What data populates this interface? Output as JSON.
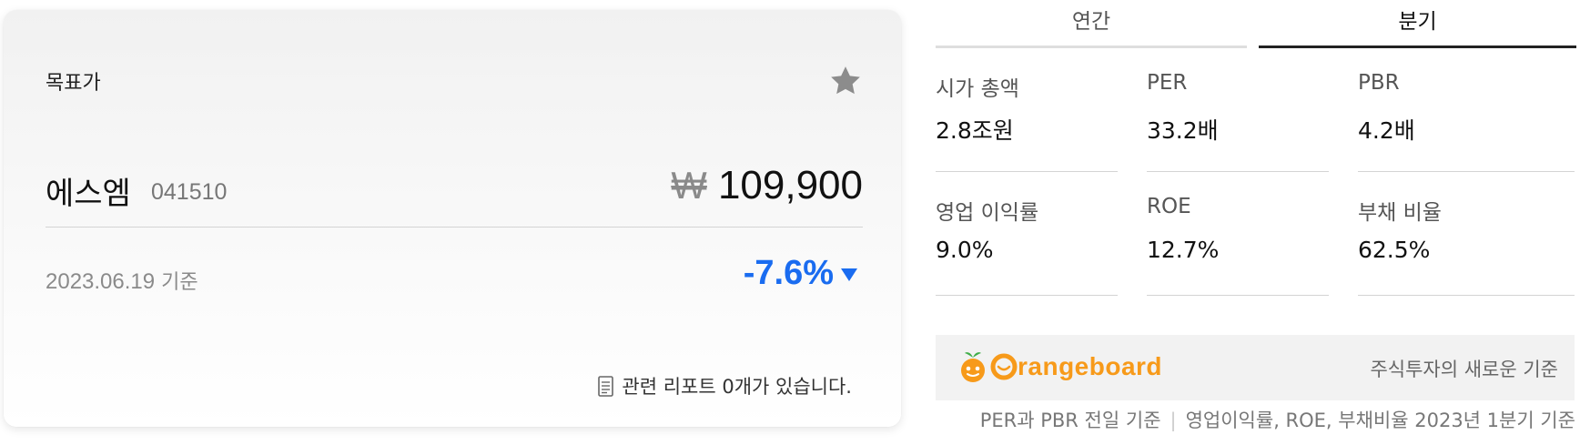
{
  "target_card": {
    "title": "목표가",
    "stock_name": "에스엠",
    "stock_code": "041510",
    "currency_symbol": "₩",
    "price": "109,900",
    "date_value": "2023.06.19",
    "date_suffix": "기준",
    "change": "-7.6%",
    "change_color": "#1a6cf0",
    "reports_text": "관련 리포트 0개가 있습니다.",
    "icons": {
      "favorite": "star-icon",
      "reports": "document-icon",
      "change": "triangle-down-icon"
    }
  },
  "tabs": [
    {
      "label": "연간",
      "active": false
    },
    {
      "label": "분기",
      "active": true
    }
  ],
  "metrics": [
    {
      "label": "시가 총액",
      "value": "2.8조원"
    },
    {
      "label": "PER",
      "value": "33.2배"
    },
    {
      "label": "PBR",
      "value": "4.2배"
    },
    {
      "label": "영업 이익률",
      "value": "9.0%"
    },
    {
      "label": "ROE",
      "value": "12.7%"
    },
    {
      "label": "부채 비율",
      "value": "62.5%"
    }
  ],
  "banner": {
    "brand": "Orangeboard",
    "brand_rest": "rangeboard",
    "brand_color": "#f79a1a",
    "tagline": "주식투자의 새로운 기준"
  },
  "footnote": {
    "left": "PER과 PBR 전일 기준",
    "right": "영업이익률, ROE, 부채비율 2023년 1분기 기준"
  }
}
